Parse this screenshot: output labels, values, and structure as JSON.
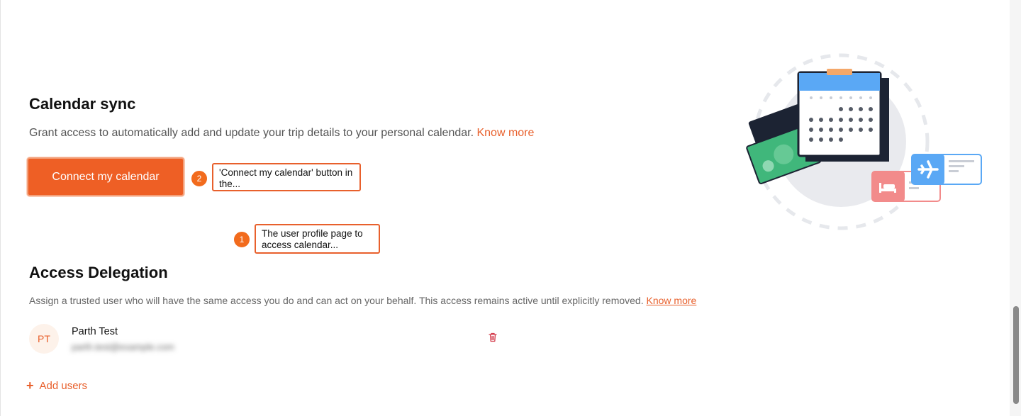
{
  "calendar_sync": {
    "title": "Calendar sync",
    "description": "Grant access to automatically add and update your trip details to your personal calendar.",
    "know_more": "Know more",
    "connect_button": "Connect my calendar"
  },
  "annotations": [
    {
      "number": "1",
      "text": "The user profile page to access calendar..."
    },
    {
      "number": "2",
      "text": "'Connect my calendar' button in the..."
    }
  ],
  "access_delegation": {
    "title": "Access Delegation",
    "description": "Assign a trusted user who will have the same access you do and can act on your behalf. This access remains active until explicitly removed.",
    "know_more": "Know more",
    "users": [
      {
        "initials": "PT",
        "name": "Parth Test",
        "email": "parth.test@example.com"
      }
    ],
    "add_users": "Add users"
  },
  "colors": {
    "accent": "#ee5f25",
    "link": "#e8602c",
    "badge": "#f26b1d"
  },
  "icons": {
    "delete": "trash-icon",
    "add": "plus-icon"
  }
}
